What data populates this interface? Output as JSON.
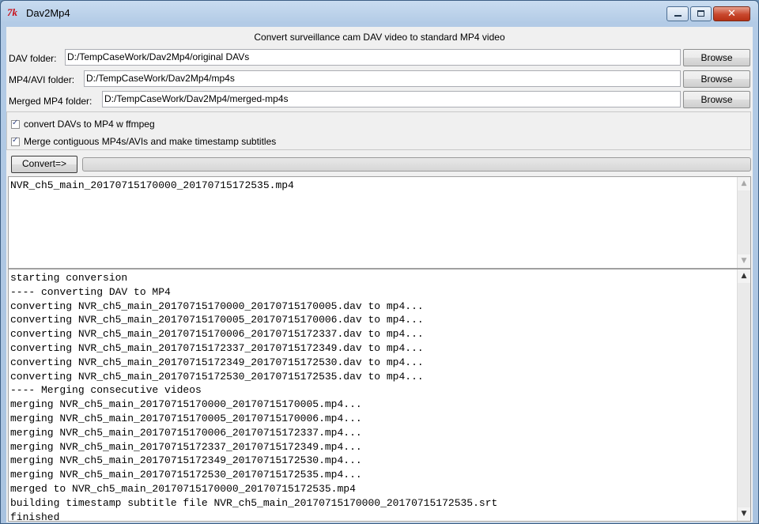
{
  "window": {
    "app_icon": "tk-feather-icon",
    "icon_text": "7k",
    "title": "Dav2Mp4",
    "minimize_icon": "minimize-icon",
    "maximize_icon": "maximize-icon",
    "close_icon": "close-icon",
    "close_glyph": "✕"
  },
  "header": {
    "subtitle": "Convert surveillance cam DAV video to standard MP4 video"
  },
  "folders": [
    {
      "label": "DAV folder:",
      "value": "D:/TempCaseWork/Dav2Mp4/original DAVs",
      "button": "Browse"
    },
    {
      "label": "MP4/AVI folder:",
      "value": "D:/TempCaseWork/Dav2Mp4/mp4s",
      "button": "Browse"
    },
    {
      "label": "Merged MP4 folder:",
      "value": "D:/TempCaseWork/Dav2Mp4/merged-mp4s",
      "button": "Browse"
    }
  ],
  "options": [
    {
      "label": "convert DAVs to MP4 w ffmpeg",
      "checked": true
    },
    {
      "label": "Merge contiguous MP4s/AVIs and make timestamp subtitles",
      "checked": true
    }
  ],
  "actions": {
    "convert_label": "Convert=>",
    "progress": 0
  },
  "output_box": {
    "text": "NVR_ch5_main_20170715170000_20170715172535.mp4"
  },
  "log_box": {
    "lines": [
      "starting conversion",
      "---- converting DAV to MP4",
      "converting NVR_ch5_main_20170715170000_20170715170005.dav to mp4...",
      "converting NVR_ch5_main_20170715170005_20170715170006.dav to mp4...",
      "converting NVR_ch5_main_20170715170006_20170715172337.dav to mp4...",
      "converting NVR_ch5_main_20170715172337_20170715172349.dav to mp4...",
      "converting NVR_ch5_main_20170715172349_20170715172530.dav to mp4...",
      "converting NVR_ch5_main_20170715172530_20170715172535.dav to mp4...",
      "---- Merging consecutive videos",
      "merging NVR_ch5_main_20170715170000_20170715170005.mp4...",
      "merging NVR_ch5_main_20170715170005_20170715170006.mp4...",
      "merging NVR_ch5_main_20170715170006_20170715172337.mp4...",
      "merging NVR_ch5_main_20170715172337_20170715172349.mp4...",
      "merging NVR_ch5_main_20170715172349_20170715172530.mp4...",
      "merging NVR_ch5_main_20170715172530_20170715172535.mp4...",
      "merged to NVR_ch5_main_20170715170000_20170715172535.mp4",
      "building timestamp subtitle file NVR_ch5_main_20170715170000_20170715172535.srt",
      "finished"
    ]
  },
  "scrollbar": {
    "up_glyph": "▲",
    "down_glyph": "▼"
  }
}
